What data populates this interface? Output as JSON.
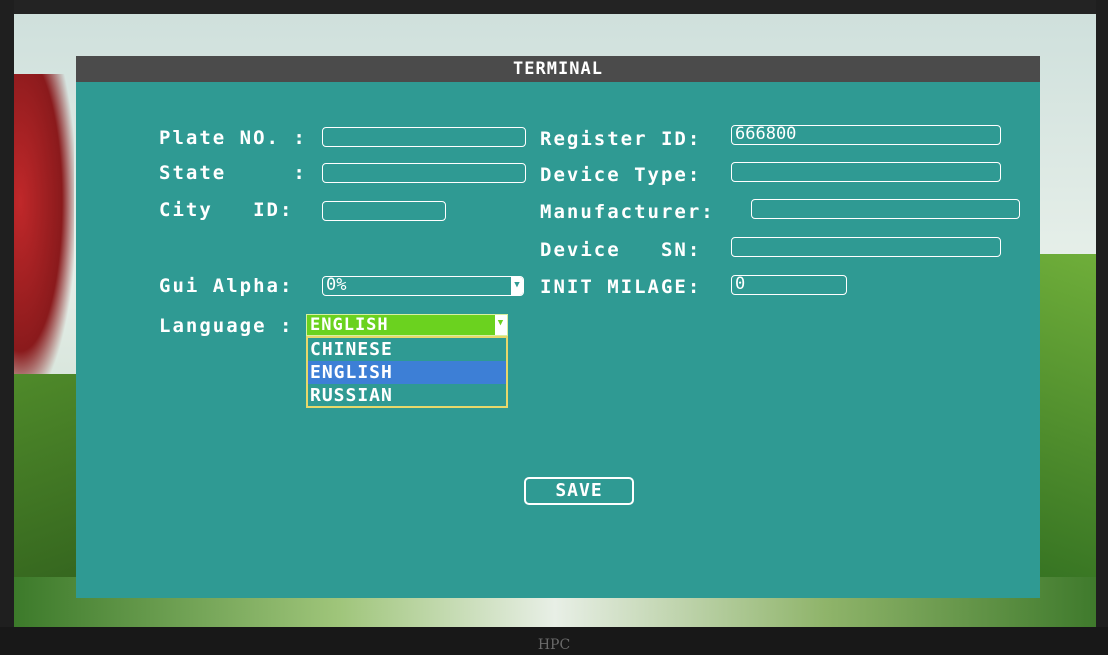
{
  "window": {
    "title": "TERMINAL"
  },
  "fields": {
    "plate_no": {
      "label": "Plate NO. :",
      "value": ""
    },
    "state": {
      "label": "State     :",
      "value": ""
    },
    "city_id": {
      "label": "City   ID:",
      "value": ""
    },
    "register_id": {
      "label": "Register ID:",
      "value": "666800"
    },
    "device_type": {
      "label": "Device Type:",
      "value": ""
    },
    "manufacturer": {
      "label": "Manufacturer:",
      "value": ""
    },
    "device_sn": {
      "label": "Device   SN:",
      "value": ""
    },
    "gui_alpha": {
      "label": "Gui Alpha:",
      "value": "0%"
    },
    "init_milage": {
      "label": "INIT MILAGE:",
      "value": "0"
    }
  },
  "language": {
    "label": "Language :",
    "selected": "ENGLISH",
    "options": [
      "CHINESE",
      "ENGLISH",
      "RUSSIAN"
    ],
    "highlighted_index": 1
  },
  "buttons": {
    "save": "SAVE"
  },
  "monitor": {
    "brand": "HPC"
  },
  "colors": {
    "panel": "#2f9a93",
    "titlebar": "#4b4b4b",
    "selected_green": "#6bd21f",
    "highlight_blue": "#3d7fd6",
    "dropdown_border": "#e8d86a"
  },
  "icons": {
    "dropdown_arrow": "chevron-down-icon"
  }
}
